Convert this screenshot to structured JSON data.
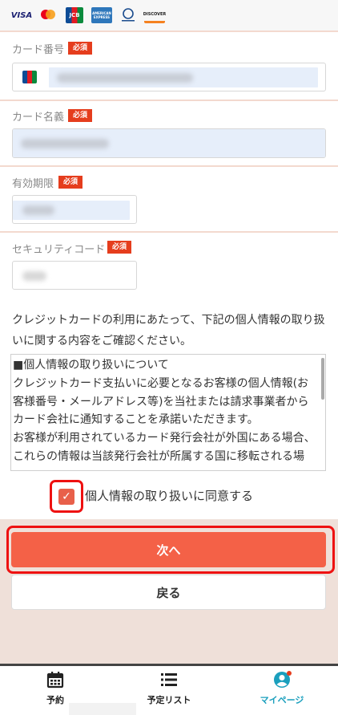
{
  "card_brands": [
    "VISA",
    "Mastercard",
    "JCB",
    "AMERICAN EXPRESS",
    "Diners Club",
    "DISCOVER"
  ],
  "form": {
    "required_badge": "必須",
    "card_number_label": "カード番号",
    "card_name_label": "カード名義",
    "expiry_label": "有効期限",
    "security_code_label": "セキュリティコード"
  },
  "intro_text": "クレジットカードの利用にあたって、下記の個人情報の取り扱いに関する内容をご確認ください。",
  "privacy_box": {
    "lines": [
      "■個人情報の取り扱いについて",
      "クレジットカード支払いに必要となるお客様の個人情報(お",
      "客様番号・メールアドレス等)を当社または請求事業者から",
      "カード会社に通知することを承諾いただきます。",
      "お客様が利用されているカード発行会社が外国にある場合、",
      "これらの情報は当該発行会社が所属する国に移転される場"
    ]
  },
  "agree": {
    "label": "個人情報の取り扱いに同意する",
    "checked": true
  },
  "buttons": {
    "next": "次へ",
    "back": "戻る"
  },
  "tabs": [
    {
      "label": "予約",
      "icon": "calendar-icon"
    },
    {
      "label": "予定リスト",
      "icon": "list-icon"
    },
    {
      "label": "マイページ",
      "icon": "user-icon",
      "active": true,
      "color": "#1a9fbd"
    }
  ],
  "colors": {
    "accent": "#f46147",
    "required": "#e53d1d",
    "highlight": "#ee1111",
    "tab_active": "#1a9fbd"
  }
}
